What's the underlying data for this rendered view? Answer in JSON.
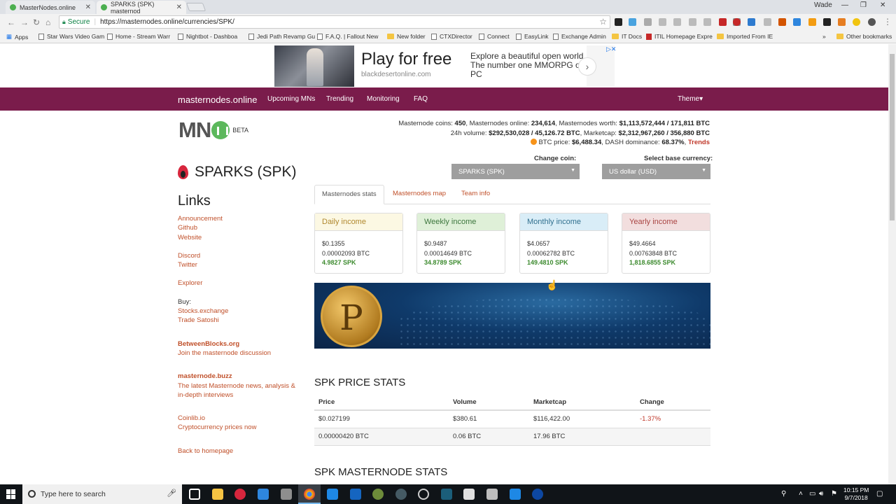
{
  "browser": {
    "tabs": [
      {
        "label": "MasterNodes.online"
      },
      {
        "label": "SPARKS (SPK) masternod"
      }
    ],
    "user": "Wade",
    "secure_label": "Secure",
    "url": "https://masternodes.online/currencies/SPK/",
    "bookmarks": [
      "Apps",
      "Star Wars Video Gam",
      "Home - Stream Warr",
      "Nightbot - Dashboa",
      "Jedi Path Revamp Gu",
      "F.A.Q. | Fallout New",
      "New folder",
      "CTXDirector",
      "Connect",
      "EasyLink",
      "Exchange Admin",
      "IT Docs",
      "ITIL Homepage Expre",
      "Imported From IE",
      "Other bookmarks"
    ]
  },
  "ad": {
    "title": "Play for free",
    "domain": "blackdesertonline.com",
    "desc": "Explore a beautiful open world. The number one MMORPG on PC"
  },
  "navbar": {
    "brand": "masternodes.online",
    "items": [
      "Upcoming MNs",
      "Trending",
      "Monitoring",
      "FAQ"
    ],
    "theme": "Theme▾"
  },
  "logo": {
    "text": "MN",
    "beta": "BETA"
  },
  "stats": {
    "coins_label": "Masternode coins:",
    "coins": "450",
    "online_label": "Masternodes online:",
    "online": "234,614",
    "worth_label": "Masternodes worth:",
    "worth": "$1,113,572,444 / 171,811 BTC",
    "vol_label": "24h volume:",
    "vol": "$292,530,028 / 45,126.72 BTC",
    "mcap_label": "Marketcap:",
    "mcap": "$2,312,967,260 / 356,880 BTC",
    "btc_label": "BTC price:",
    "btc": "$6,488.34",
    "dash_label": "DASH dominance:",
    "dash": "68.37%",
    "trends": "Trends"
  },
  "selectors": {
    "coin_label": "Change coin:",
    "coin_value": "SPARKS (SPK)",
    "base_label": "Select base currency:",
    "base_value": "US dollar (USD)"
  },
  "coin": {
    "title": "SPARKS (SPK)"
  },
  "sidebar": {
    "heading": "Links",
    "links1": [
      "Announcement",
      "Github",
      "Website"
    ],
    "links2": [
      "Discord",
      "Twitter"
    ],
    "explorer": "Explorer",
    "buy_label": "Buy:",
    "buy": [
      "Stocks.exchange",
      "Trade Satoshi"
    ],
    "bb_title": "BetweenBlocks.org",
    "bb_sub": "Join the masternode discussion",
    "buzz_title": "masternode.buzz",
    "buzz_sub": "The latest Masternode news, analysis & in-depth interviews",
    "coinlib_title": "Coinlib.io",
    "coinlib_sub": "Cryptocurrency prices now",
    "back": "Back to homepage"
  },
  "tabs": [
    "Masternodes stats",
    "Masternodes map",
    "Team info"
  ],
  "income": [
    {
      "title": "Daily income",
      "usd": "$0.1355",
      "btc": "0.00002093 BTC",
      "spk": "4.9827 SPK",
      "color": "#fcf8e3",
      "text": "#b0882e"
    },
    {
      "title": "Weekly income",
      "usd": "$0.9487",
      "btc": "0.00014649 BTC",
      "spk": "34.8789 SPK",
      "color": "#dff0d8",
      "text": "#3c763d"
    },
    {
      "title": "Monthly income",
      "usd": "$4.0657",
      "btc": "0.00062782 BTC",
      "spk": "149.4810 SPK",
      "color": "#d9edf7",
      "text": "#31708f"
    },
    {
      "title": "Yearly income",
      "usd": "$49.4664",
      "btc": "0.00763848 BTC",
      "spk": "1,818.6855 SPK",
      "color": "#f2dede",
      "text": "#a94442"
    }
  ],
  "price_stats": {
    "heading": "SPK PRICE STATS",
    "headers": [
      "Price",
      "Volume",
      "Marketcap",
      "Change"
    ],
    "rows": [
      [
        "$0.027199",
        "$380.61",
        "$116,422.00",
        "-1.37%"
      ],
      [
        "0.00000420 BTC",
        "0.06 BTC",
        "17.96 BTC",
        ""
      ]
    ]
  },
  "mn_stats": {
    "heading": "SPK MASTERNODE STATS"
  },
  "taskbar": {
    "search_placeholder": "Type here to search",
    "time": "10:15 PM",
    "date": "9/7/2018"
  }
}
